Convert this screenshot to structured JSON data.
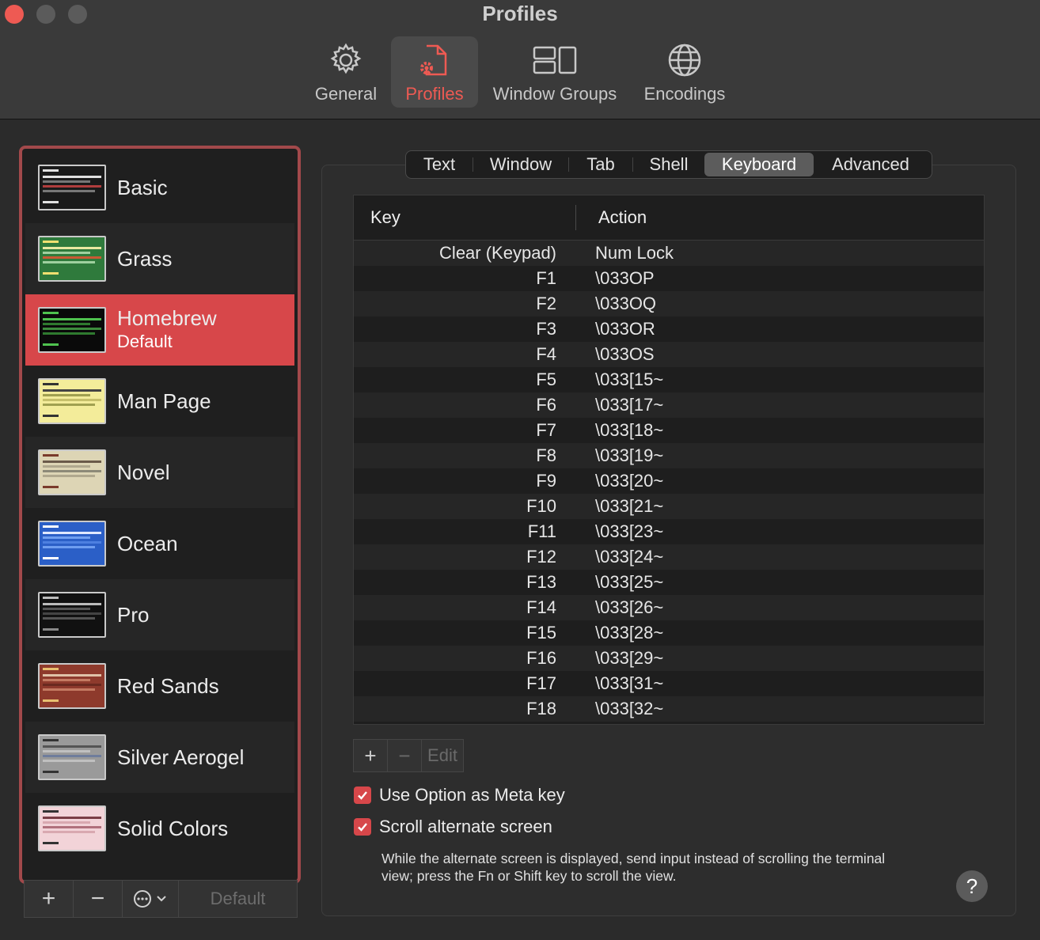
{
  "window": {
    "title": "Profiles"
  },
  "toolbar": [
    {
      "label": "General",
      "icon": "gear-icon",
      "active": false
    },
    {
      "label": "Profiles",
      "icon": "profile-doc-icon",
      "active": true
    },
    {
      "label": "Window Groups",
      "icon": "window-groups-icon",
      "active": false
    },
    {
      "label": "Encodings",
      "icon": "globe-icon",
      "active": false
    }
  ],
  "profiles": [
    {
      "name": "Basic",
      "sub": "",
      "thumb_bg": "#1a1a1a",
      "thumb_hl": "#b03d3d"
    },
    {
      "name": "Grass",
      "sub": "",
      "thumb_bg": "#2f7a3c",
      "thumb_hl": "#c95a35"
    },
    {
      "name": "Homebrew",
      "sub": "Default",
      "thumb_bg": "#0a0a0a",
      "thumb_hl": "#3d8c3d"
    },
    {
      "name": "Man Page",
      "sub": "",
      "thumb_bg": "#f3ec9a",
      "thumb_hl": "#a0a050"
    },
    {
      "name": "Novel",
      "sub": "",
      "thumb_bg": "#ddd5b5",
      "thumb_hl": "#8d8a78"
    },
    {
      "name": "Ocean",
      "sub": "",
      "thumb_bg": "#2b5fc7",
      "thumb_hl": "#6f9ef0"
    },
    {
      "name": "Pro",
      "sub": "",
      "thumb_bg": "#111111",
      "thumb_hl": "#555555"
    },
    {
      "name": "Red Sands",
      "sub": "",
      "thumb_bg": "#8e3a2c",
      "thumb_hl": "#c47a62"
    },
    {
      "name": "Silver Aerogel",
      "sub": "",
      "thumb_bg": "#9a9a9a",
      "thumb_hl": "#6f7d9c"
    },
    {
      "name": "Solid Colors",
      "sub": "",
      "thumb_bg": "#f2d3d8",
      "thumb_hl": "#7a3d45"
    }
  ],
  "sidebar_buttons": {
    "add": "+",
    "remove": "−",
    "more": "⋯⌄",
    "default": "Default"
  },
  "tabs": [
    "Text",
    "Window",
    "Tab",
    "Shell",
    "Keyboard",
    "Advanced"
  ],
  "active_tab": "Keyboard",
  "table": {
    "headers": {
      "key": "Key",
      "action": "Action"
    },
    "rows": [
      {
        "key": "Clear (Keypad)",
        "action": "Num Lock"
      },
      {
        "key": "F1",
        "action": "\\033OP"
      },
      {
        "key": "F2",
        "action": "\\033OQ"
      },
      {
        "key": "F3",
        "action": "\\033OR"
      },
      {
        "key": "F4",
        "action": "\\033OS"
      },
      {
        "key": "F5",
        "action": "\\033[15~"
      },
      {
        "key": "F6",
        "action": "\\033[17~"
      },
      {
        "key": "F7",
        "action": "\\033[18~"
      },
      {
        "key": "F8",
        "action": "\\033[19~"
      },
      {
        "key": "F9",
        "action": "\\033[20~"
      },
      {
        "key": "F10",
        "action": "\\033[21~"
      },
      {
        "key": "F11",
        "action": "\\033[23~"
      },
      {
        "key": "F12",
        "action": "\\033[24~"
      },
      {
        "key": "F13",
        "action": "\\033[25~"
      },
      {
        "key": "F14",
        "action": "\\033[26~"
      },
      {
        "key": "F15",
        "action": "\\033[28~"
      },
      {
        "key": "F16",
        "action": "\\033[29~"
      },
      {
        "key": "F17",
        "action": "\\033[31~"
      },
      {
        "key": "F18",
        "action": "\\033[32~"
      }
    ]
  },
  "table_buttons": {
    "add": "+",
    "remove": "−",
    "edit": "Edit"
  },
  "options": {
    "meta_key": {
      "label": "Use Option as Meta key",
      "checked": true
    },
    "scroll_alt": {
      "label": "Scroll alternate screen",
      "checked": true
    }
  },
  "note": "While the alternate screen is displayed, send input instead of scrolling the terminal view; press the Fn or Shift key to scroll the view.",
  "help": "?",
  "colors": {
    "accent": "#d7474a",
    "accent_text": "#ee5a53",
    "selection_border": "#a2494b"
  }
}
